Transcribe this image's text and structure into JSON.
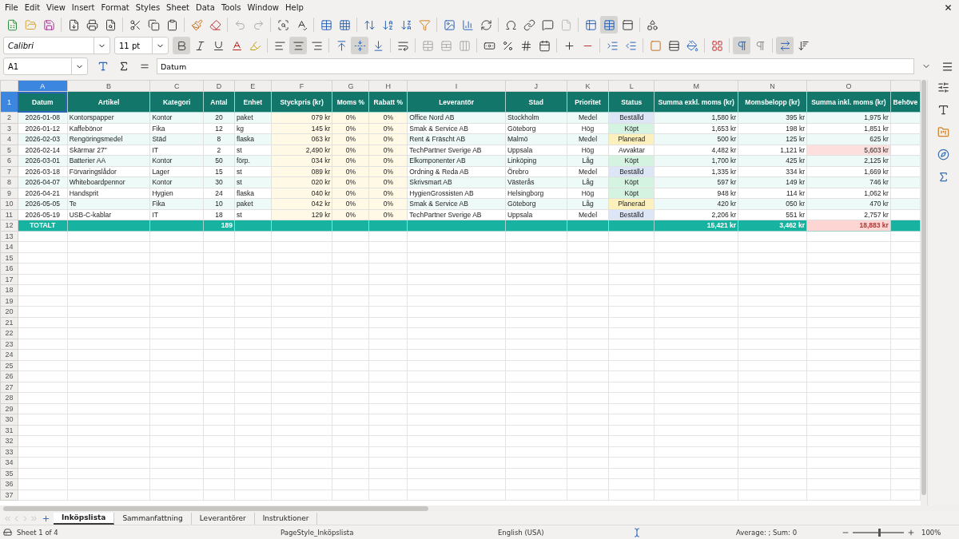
{
  "menu": [
    "File",
    "Edit",
    "View",
    "Insert",
    "Format",
    "Styles",
    "Sheet",
    "Data",
    "Tools",
    "Window",
    "Help"
  ],
  "format_bar": {
    "font": "Calibri",
    "size": "11 pt",
    "bold": true,
    "italic": false,
    "underline": false,
    "align_center": true,
    "valign_middle": true,
    "ltr": true,
    "wrap": true
  },
  "formula_bar": {
    "cell": "A1",
    "value": "Datum"
  },
  "columns": [
    "A",
    "B",
    "C",
    "D",
    "E",
    "F",
    "G",
    "H",
    "I",
    "J",
    "K",
    "L",
    "M",
    "N",
    "O"
  ],
  "header_row_number": "1",
  "headers": [
    "Datum",
    "Artikel",
    "Kategori",
    "Antal",
    "Enhet",
    "Styckpris (kr)",
    "Moms %",
    "Rabatt %",
    "Leverantör",
    "Stad",
    "Prioritet",
    "Status",
    "Summa exkl. moms (kr)",
    "Momsbelopp (kr)",
    "Summa inkl. moms (kr)",
    "Behöve"
  ],
  "rows": [
    {
      "number": "2",
      "cells": [
        "2026-01-08",
        "Kontorspapper",
        "Kontor",
        "20",
        "paket",
        "079 kr",
        "0%",
        "0%",
        "Office Nord AB",
        "Stockholm",
        "Medel",
        "Beställd",
        "1,580 kr",
        "395 kr",
        "1,975 kr"
      ],
      "color": "#dce6f7",
      "flagged": false
    },
    {
      "number": "3",
      "cells": [
        "2026-01-12",
        "Kaffebönor",
        "Fika",
        "12",
        "kg",
        "145 kr",
        "0%",
        "0%",
        "Smak & Service AB",
        "Göteborg",
        "Hög",
        "Köpt",
        "1,653 kr",
        "198 kr",
        "1,851 kr"
      ],
      "color": "#d4f3e1",
      "flagged": false
    },
    {
      "number": "4",
      "cells": [
        "2026-02-03",
        "Rengöringsmedel",
        "Städ",
        "8",
        "flaska",
        "063 kr",
        "0%",
        "0%",
        "Rent & Fräscht AB",
        "Malmö",
        "Medel",
        "Planerad",
        "500 kr",
        "125 kr",
        "625 kr"
      ],
      "color": "#fcf1bd",
      "flagged": false
    },
    {
      "number": "5",
      "cells": [
        "2026-02-14",
        "Skärmar 27\"",
        "IT",
        "2",
        "st",
        "2,490 kr",
        "0%",
        "0%",
        "TechPartner Sverige AB",
        "Uppsala",
        "Hög",
        "Avvaktar",
        "4,482 kr",
        "1,121 kr",
        "5,603 kr"
      ],
      "color": "#ffffff",
      "flagged": true
    },
    {
      "number": "6",
      "cells": [
        "2026-03-01",
        "Batterier AA",
        "Kontor",
        "50",
        "förp.",
        "034 kr",
        "0%",
        "0%",
        "Elkomponenter AB",
        "Linköping",
        "Låg",
        "Köpt",
        "1,700 kr",
        "425 kr",
        "2,125 kr"
      ],
      "color": "#d4f3e1",
      "flagged": false
    },
    {
      "number": "7",
      "cells": [
        "2026-03-18",
        "Förvaringslådor",
        "Lager",
        "15",
        "st",
        "089 kr",
        "0%",
        "0%",
        "Ordning & Reda AB",
        "Örebro",
        "Medel",
        "Beställd",
        "1,335 kr",
        "334 kr",
        "1,669 kr"
      ],
      "color": "#dce6f7",
      "flagged": false
    },
    {
      "number": "8",
      "cells": [
        "2026-04-07",
        "Whiteboardpennor",
        "Kontor",
        "30",
        "st",
        "020 kr",
        "0%",
        "0%",
        "Skrivsmart AB",
        "Västerås",
        "Låg",
        "Köpt",
        "597 kr",
        "149 kr",
        "746 kr"
      ],
      "color": "#d4f3e1",
      "flagged": false
    },
    {
      "number": "9",
      "cells": [
        "2026-04-21",
        "Handsprit",
        "Hygien",
        "24",
        "flaska",
        "040 kr",
        "0%",
        "0%",
        "HygienGrossisten AB",
        "Helsingborg",
        "Hög",
        "Köpt",
        "948 kr",
        "114 kr",
        "1,062 kr"
      ],
      "color": "#d4f3e1",
      "flagged": false
    },
    {
      "number": "10",
      "cells": [
        "2026-05-05",
        "Te",
        "Fika",
        "10",
        "paket",
        "042 kr",
        "0%",
        "0%",
        "Smak & Service AB",
        "Göteborg",
        "Låg",
        "Planerad",
        "420 kr",
        "050 kr",
        "470 kr"
      ],
      "color": "#fcf1bd",
      "flagged": false
    },
    {
      "number": "11",
      "cells": [
        "2026-05-19",
        "USB-C-kablar",
        "IT",
        "18",
        "st",
        "129 kr",
        "0%",
        "0%",
        "TechPartner Sverige AB",
        "Uppsala",
        "Medel",
        "Beställd",
        "2,206 kr",
        "551 kr",
        "2,757 kr"
      ],
      "color": "#dce6f7",
      "flagged": false
    }
  ],
  "totals": {
    "number": "12",
    "label": "TOTALT",
    "qty": "189",
    "sum_ex": "15,421 kr",
    "vat": "3,462 kr",
    "sum_inc": "18,883 kr",
    "flagged": true
  },
  "empty_rows": [
    "13",
    "14",
    "15",
    "16",
    "17",
    "18",
    "19",
    "20",
    "21",
    "22",
    "23",
    "24",
    "25",
    "26",
    "27",
    "28",
    "29",
    "30",
    "31",
    "32",
    "33",
    "34",
    "35",
    "36",
    "37"
  ],
  "sheet_tabs": [
    {
      "label": "Inköpslista",
      "selected": true
    },
    {
      "label": "Sammanfattning",
      "selected": false
    },
    {
      "label": "Leverantörer",
      "selected": false
    },
    {
      "label": "Instruktioner",
      "selected": false
    }
  ],
  "status_bar": {
    "sheet": "Sheet 1 of 4",
    "page_style": "PageStyle_Inköpslista",
    "language": "English (USA)",
    "summary": "Average: ; Sum: 0",
    "zoom": {
      "level": 0.5,
      "label": "100%"
    }
  }
}
